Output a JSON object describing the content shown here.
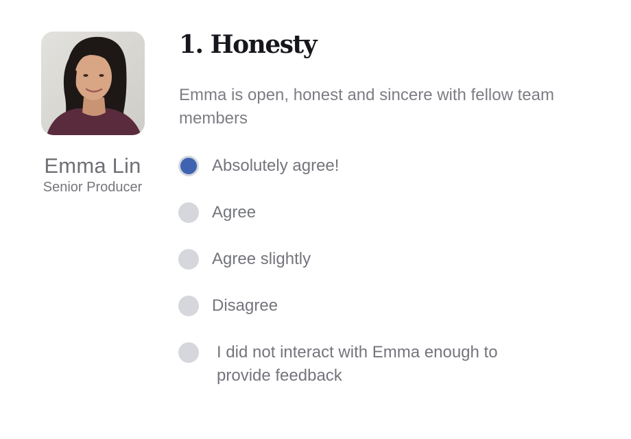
{
  "person": {
    "name": "Emma Lin",
    "role": "Senior Producer"
  },
  "question": {
    "title": "1. Honesty",
    "description": "Emma is open, honest and sincere with fellow team members",
    "options": [
      {
        "label": "Absolutely agree!",
        "selected": true
      },
      {
        "label": "Agree",
        "selected": false
      },
      {
        "label": "Agree slightly",
        "selected": false
      },
      {
        "label": "Disagree",
        "selected": false
      },
      {
        "label": "I did not interact with Emma enough to provide feedback",
        "selected": false
      }
    ]
  },
  "colors": {
    "selected_radio": "#3f63b0",
    "unselected_radio": "#d5d7dc",
    "title": "#16171c",
    "body_text": "#74757c"
  }
}
